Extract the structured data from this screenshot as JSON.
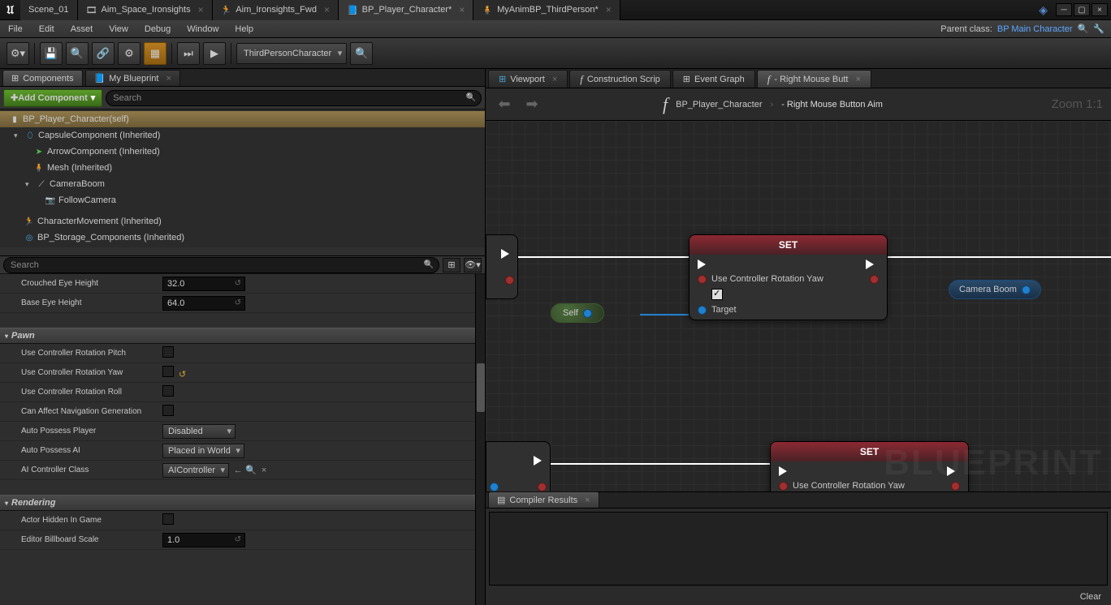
{
  "title_tabs": [
    {
      "label": "Scene_01"
    },
    {
      "label": "Aim_Space_Ironsights"
    },
    {
      "label": "Aim_Ironsights_Fwd"
    },
    {
      "label": "BP_Player_Character*",
      "active": true
    },
    {
      "label": "MyAnimBP_ThirdPerson*"
    }
  ],
  "menus": [
    "File",
    "Edit",
    "Asset",
    "View",
    "Debug",
    "Window",
    "Help"
  ],
  "parent_label": "Parent class:",
  "parent_class": "BP Main Character",
  "toolbar_select": "ThirdPersonCharacter",
  "panel_tabs": {
    "components": "Components",
    "blueprint": "My Blueprint"
  },
  "add_component": "Add Component",
  "search_placeholder": "Search",
  "tree": [
    {
      "indent": 0,
      "label": "BP_Player_Character(self)",
      "root": true
    },
    {
      "indent": 1,
      "caret": "▾",
      "label": "CapsuleComponent (Inherited)"
    },
    {
      "indent": 2,
      "label": "ArrowComponent (Inherited)"
    },
    {
      "indent": 2,
      "label": "Mesh (Inherited)"
    },
    {
      "indent": 2,
      "caret": "▾",
      "label": "CameraBoom"
    },
    {
      "indent": 3,
      "label": "FollowCamera"
    },
    {
      "indent": 1,
      "label": "CharacterMovement (Inherited)"
    },
    {
      "indent": 1,
      "label": "BP_Storage_Components (Inherited)"
    }
  ],
  "props_top": [
    {
      "label": "Crouched Eye Height",
      "value": "32.0"
    },
    {
      "label": "Base Eye Height",
      "value": "64.0"
    }
  ],
  "cat_pawn": "Pawn",
  "pawn_props": [
    {
      "label": "Use Controller Rotation Pitch",
      "type": "chk"
    },
    {
      "label": "Use Controller Rotation Yaw",
      "type": "chk",
      "revert": true
    },
    {
      "label": "Use Controller Rotation Roll",
      "type": "chk"
    },
    {
      "label": "Can Affect Navigation Generation",
      "type": "chk"
    },
    {
      "label": "Auto Possess Player",
      "type": "sel",
      "value": "Disabled"
    },
    {
      "label": "Auto Possess AI",
      "type": "sel",
      "value": "Placed in World"
    },
    {
      "label": "AI Controller Class",
      "type": "sel",
      "value": "AIController",
      "extra": true
    }
  ],
  "cat_rendering": "Rendering",
  "rendering_props": [
    {
      "label": "Actor Hidden In Game",
      "type": "chk"
    },
    {
      "label": "Editor Billboard Scale",
      "type": "num",
      "value": "1.0"
    }
  ],
  "right_tabs": [
    {
      "label": "Viewport"
    },
    {
      "label": "Construction Scrip",
      "f": true
    },
    {
      "label": "Event Graph",
      "f": true
    },
    {
      "label": "- Right Mouse Butt",
      "f": true,
      "active": true
    }
  ],
  "breadcrumb": {
    "a": "BP_Player_Character",
    "b": "- Right Mouse Button Aim"
  },
  "zoom": "Zoom 1:1",
  "node_set": "SET",
  "node_prop": "Use Controller Rotation Yaw",
  "node_target": "Target",
  "self_label": "Self",
  "camera_boom": "Camera Boom",
  "watermark": "BLUEPRINT",
  "compiler_tab": "Compiler Results",
  "clear": "Clear"
}
